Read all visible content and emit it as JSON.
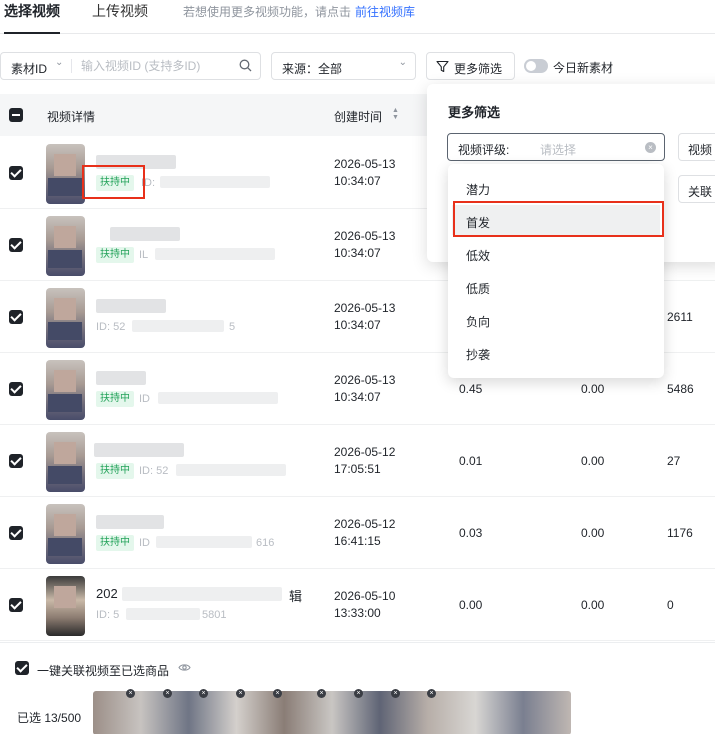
{
  "tabs": {
    "select": "选择视频",
    "upload": "上传视频"
  },
  "hint": {
    "text": "若想使用更多视频功能，请点击",
    "link": "前往视频库"
  },
  "filters": {
    "id_type": "素材ID",
    "id_placeholder": "输入视频ID (支持多ID)",
    "source": "来源：全部",
    "more": "更多筛选",
    "today_new": "今日新素材"
  },
  "table": {
    "headers": {
      "details": "视频详情",
      "created": "创建时间"
    },
    "rows": [
      {
        "title": "",
        "badge": "扶持中",
        "id_prefix": "ID:",
        "date": "2026-05-13",
        "time": "10:34:07",
        "v1": "",
        "v2": "",
        "v3": ""
      },
      {
        "title": "",
        "badge": "扶持中",
        "id_prefix": "IL",
        "date": "2026-05-13",
        "time": "10:34:07",
        "v1": "",
        "v2": "",
        "v3": ""
      },
      {
        "title": "",
        "badge": "",
        "id_prefix": "ID: 52",
        "id_suffix": "5",
        "date": "2026-05-13",
        "time": "10:34:07",
        "v1": "",
        "v2": "",
        "v3": "2611"
      },
      {
        "title": "",
        "badge": "扶持中",
        "id_prefix": "ID",
        "date": "2026-05-13",
        "time": "10:34:07",
        "v1": "0.45",
        "v2": "0.00",
        "v3": "5486"
      },
      {
        "title": "",
        "badge": "扶持中",
        "id_prefix": "ID: 52",
        "date": "2026-05-12",
        "time": "17:05:51",
        "v1": "0.01",
        "v2": "0.00",
        "v3": "27"
      },
      {
        "title": "",
        "badge": "扶持中",
        "id_prefix": "ID",
        "id_suffix": "616",
        "date": "2026-05-12",
        "time": "16:41:15",
        "v1": "0.03",
        "v2": "0.00",
        "v3": "1176"
      },
      {
        "title": "202",
        "title_suffix": "辑",
        "badge": "",
        "id_prefix": "ID: 5",
        "id_suffix": "5801",
        "date": "2026-05-10",
        "time": "13:33:00",
        "v1": "0.00",
        "v2": "0.00",
        "v3": "0"
      }
    ]
  },
  "panel": {
    "title": "更多筛选",
    "grade_label": "视频评级:",
    "grade_placeholder": "请选择",
    "side_btn_1": "视频",
    "side_btn_2": "关联"
  },
  "dropdown": {
    "options": [
      "潜力",
      "首发",
      "低效",
      "低质",
      "负向",
      "抄袭"
    ],
    "highlighted": "首发"
  },
  "footer": {
    "link_all": "一键关联视频至已选商品",
    "selected": "已选 13/500"
  },
  "colors": {
    "accent": "#3370ff",
    "badge_green": "#24a35a",
    "annotation_red": "#e8301a"
  }
}
